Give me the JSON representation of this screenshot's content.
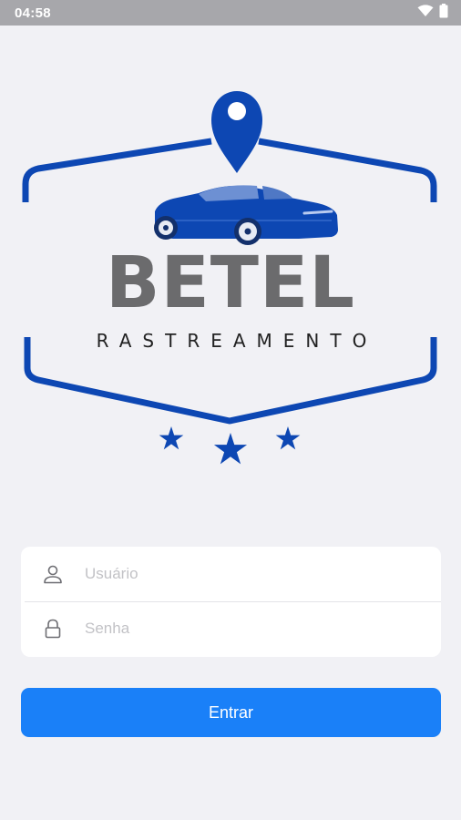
{
  "status_bar": {
    "time": "04:58",
    "icons": [
      "wifi-icon",
      "battery-icon"
    ]
  },
  "logo": {
    "name": "BETEL",
    "subtitle": "RASTREAMENTO",
    "icons": [
      "location-pin-icon",
      "car-icon",
      "star-icon"
    ]
  },
  "login_form": {
    "username": {
      "placeholder": "Usuário",
      "value": "",
      "icon": "user-icon"
    },
    "password": {
      "placeholder": "Senha",
      "value": "",
      "icon": "lock-icon"
    },
    "submit_label": "Entrar"
  },
  "colors": {
    "status_bar": "#a7a7ab",
    "background": "#f1f1f5",
    "brand_blue": "#0d47b3",
    "brand_gray": "#6b6b6d",
    "button": "#1a80f8"
  }
}
